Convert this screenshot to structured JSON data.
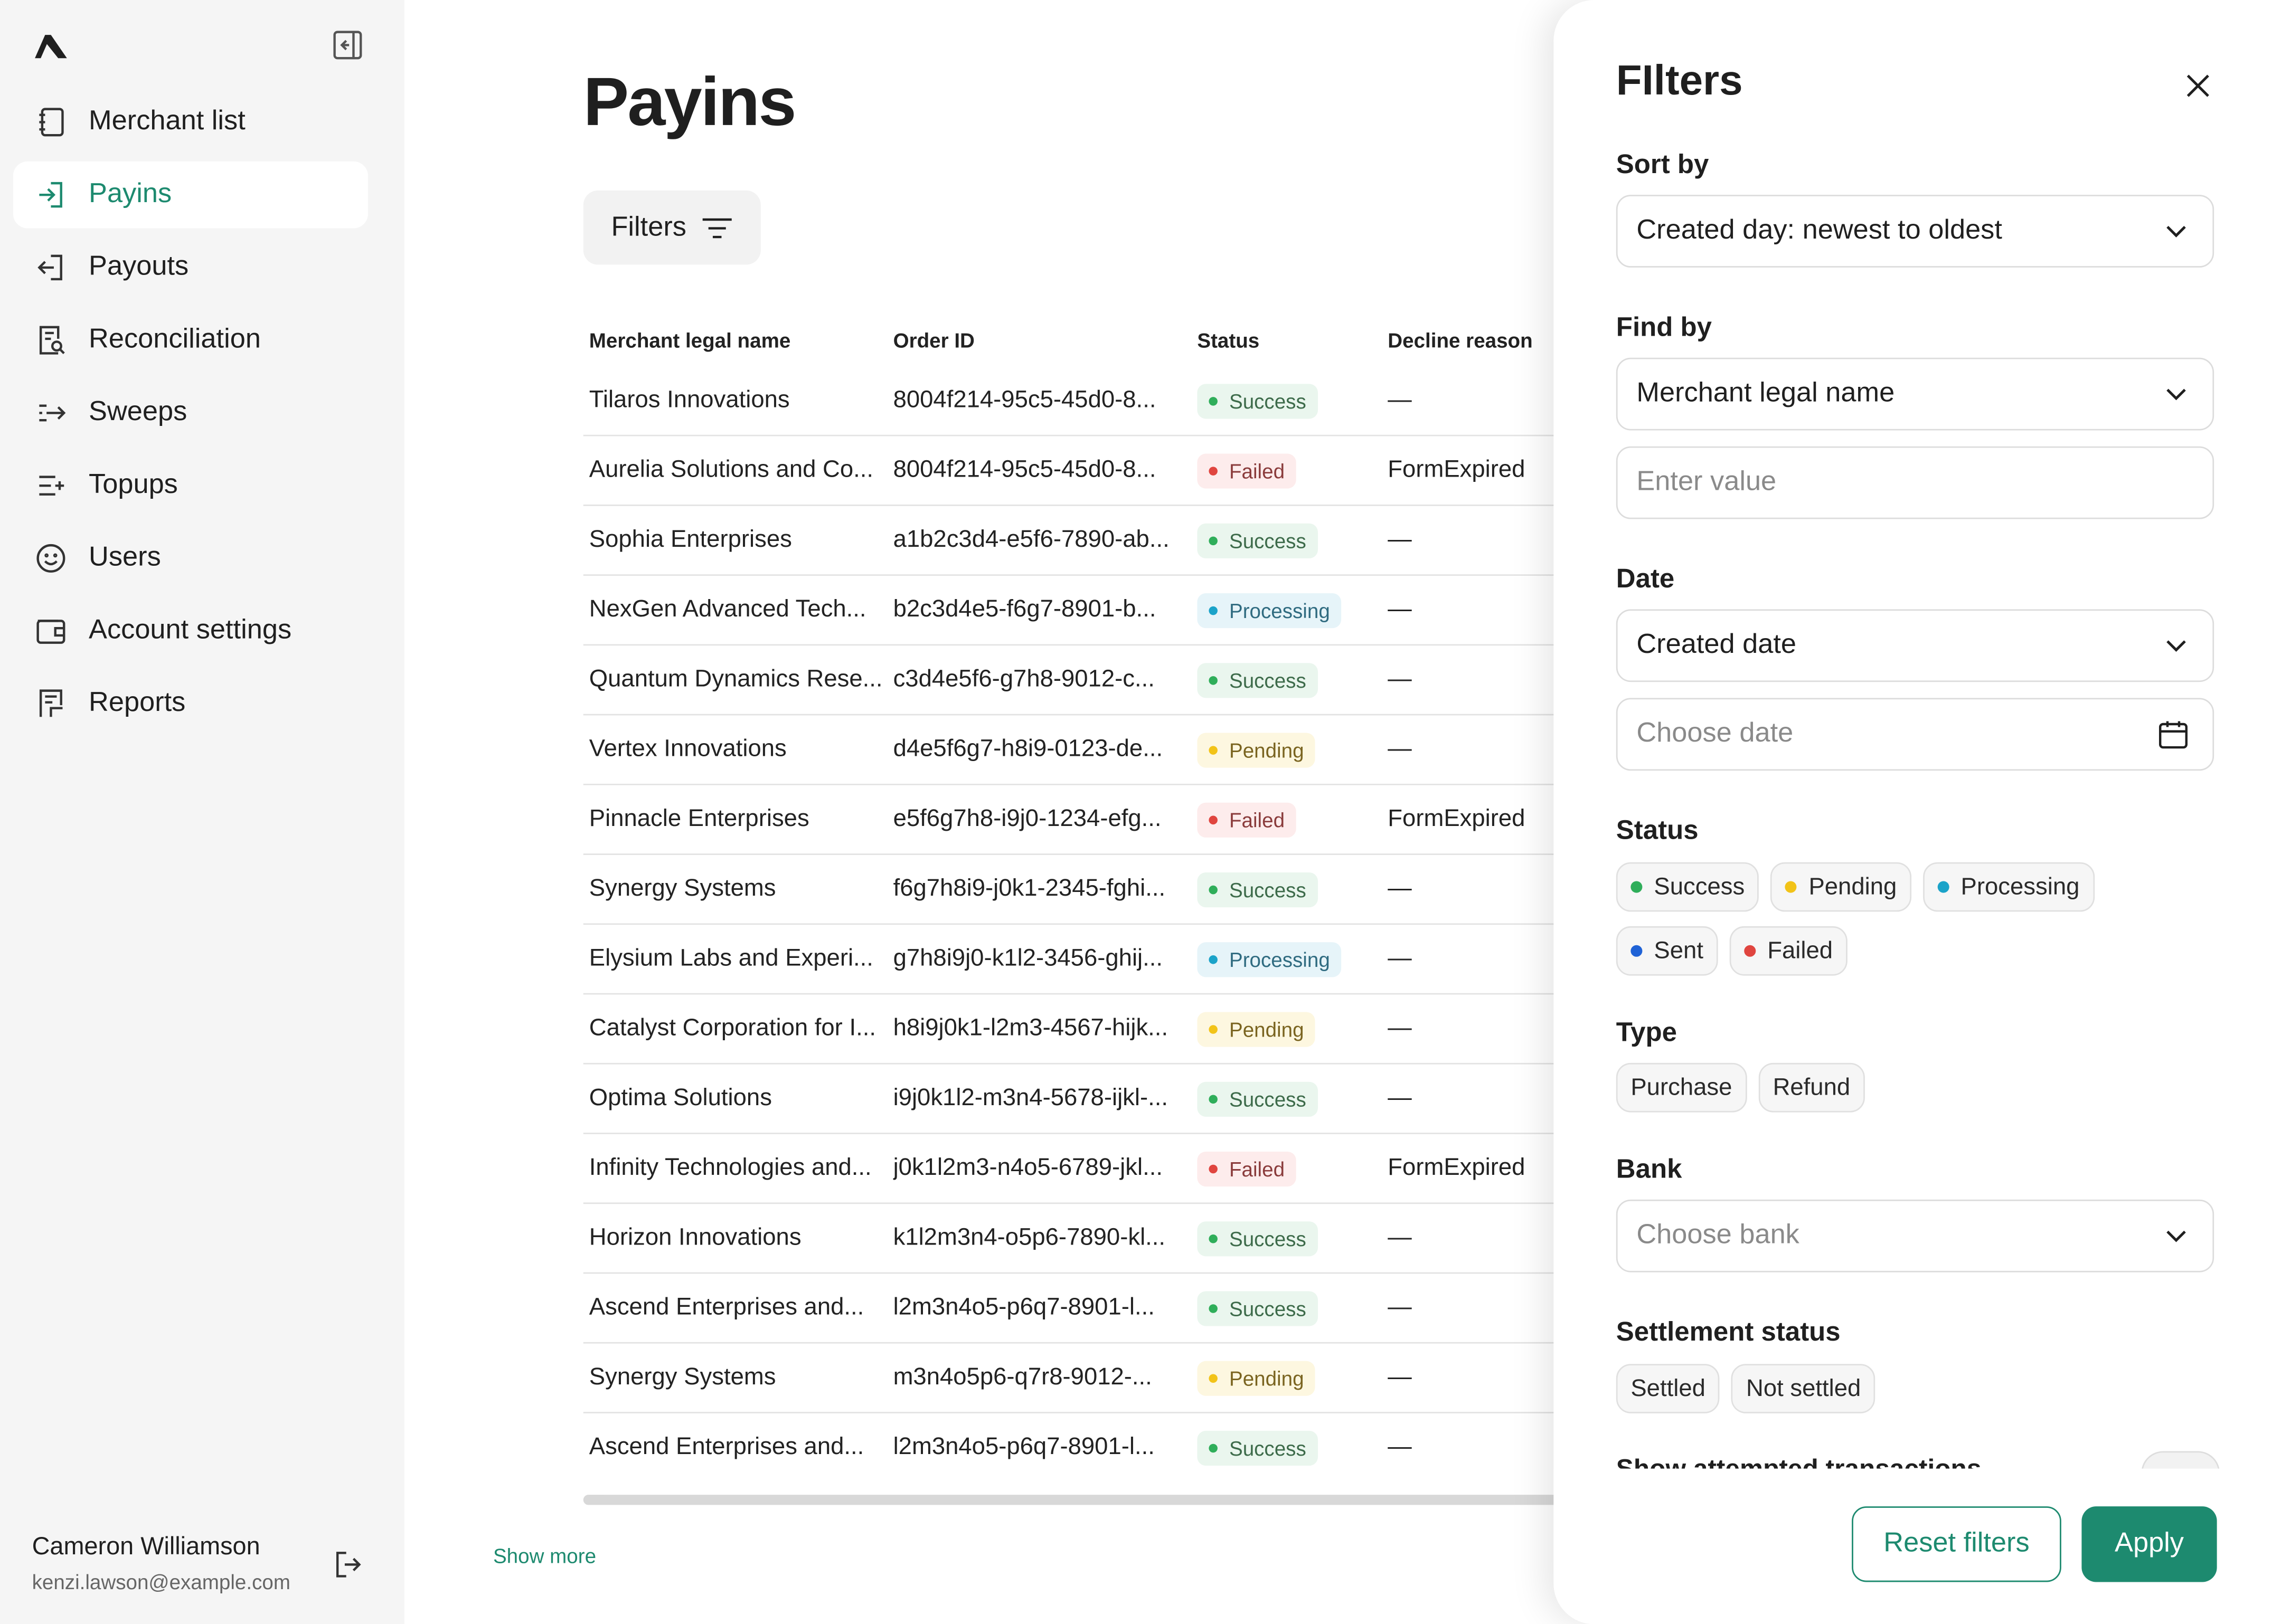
{
  "sidebar": {
    "items": [
      {
        "label": "Merchant list",
        "icon": "notebook-icon"
      },
      {
        "label": "Payins",
        "icon": "login-arrow-icon"
      },
      {
        "label": "Payouts",
        "icon": "logout-arrow-icon"
      },
      {
        "label": "Reconciliation",
        "icon": "document-search-icon"
      },
      {
        "label": "Sweeps",
        "icon": "sweep-arrow-icon"
      },
      {
        "label": "Topups",
        "icon": "list-plus-icon"
      },
      {
        "label": "Users",
        "icon": "smiley-icon"
      },
      {
        "label": "Account settings",
        "icon": "wallet-icon"
      },
      {
        "label": "Reports",
        "icon": "report-icon"
      }
    ],
    "user": {
      "name": "Cameron Williamson",
      "email": "kenzi.lawson@example.com"
    }
  },
  "main": {
    "title": "Payins",
    "filters_button": "Filters",
    "columns": [
      "Merchant legal name",
      "Order ID",
      "Status",
      "Decline reason"
    ],
    "rows": [
      {
        "merchant": "Tilaros Innovations",
        "order": "8004f214-95c5-45d0-8...",
        "status": "Success",
        "reason": "—"
      },
      {
        "merchant": "Aurelia Solutions and Co...",
        "order": "8004f214-95c5-45d0-8...",
        "status": "Failed",
        "reason": "FormExpired"
      },
      {
        "merchant": "Sophia Enterprises",
        "order": "a1b2c3d4-e5f6-7890-ab...",
        "status": "Success",
        "reason": "—"
      },
      {
        "merchant": "NexGen Advanced Tech...",
        "order": "b2c3d4e5-f6g7-8901-b...",
        "status": "Processing",
        "reason": "—"
      },
      {
        "merchant": "Quantum Dynamics Rese...",
        "order": "c3d4e5f6-g7h8-9012-c...",
        "status": "Success",
        "reason": "—"
      },
      {
        "merchant": "Vertex Innovations",
        "order": "d4e5f6g7-h8i9-0123-de...",
        "status": "Pending",
        "reason": "—"
      },
      {
        "merchant": "Pinnacle Enterprises",
        "order": "e5f6g7h8-i9j0-1234-efg...",
        "status": "Failed",
        "reason": "FormExpired"
      },
      {
        "merchant": "Synergy Systems",
        "order": "f6g7h8i9-j0k1-2345-fghi...",
        "status": "Success",
        "reason": "—"
      },
      {
        "merchant": "Elysium Labs and Experi...",
        "order": "g7h8i9j0-k1l2-3456-ghij...",
        "status": "Processing",
        "reason": "—"
      },
      {
        "merchant": "Catalyst Corporation for I...",
        "order": "h8i9j0k1-l2m3-4567-hijk...",
        "status": "Pending",
        "reason": "—"
      },
      {
        "merchant": "Optima Solutions",
        "order": "i9j0k1l2-m3n4-5678-ijkl-...",
        "status": "Success",
        "reason": "—"
      },
      {
        "merchant": "Infinity Technologies and...",
        "order": "j0k1l2m3-n4o5-6789-jkl...",
        "status": "Failed",
        "reason": "FormExpired"
      },
      {
        "merchant": "Horizon Innovations",
        "order": "k1l2m3n4-o5p6-7890-kl...",
        "status": "Success",
        "reason": "—"
      },
      {
        "merchant": "Ascend Enterprises and...",
        "order": "l2m3n4o5-p6q7-8901-l...",
        "status": "Success",
        "reason": "—"
      },
      {
        "merchant": "Synergy Systems",
        "order": "m3n4o5p6-q7r8-9012-...",
        "status": "Pending",
        "reason": "—"
      },
      {
        "merchant": "Ascend Enterprises and...",
        "order": "l2m3n4o5-p6q7-8901-l...",
        "status": "Success",
        "reason": "—"
      }
    ],
    "show_more": "Show more"
  },
  "filters": {
    "title": "FIlters",
    "sort_by": {
      "label": "Sort by",
      "value": "Created day: newest to oldest"
    },
    "find_by": {
      "label": "Find by",
      "value": "Merchant legal name",
      "placeholder": "Enter value"
    },
    "date": {
      "label": "Date",
      "value": "Created date",
      "placeholder": "Choose date"
    },
    "status": {
      "label": "Status",
      "options": [
        {
          "label": "Success",
          "color": "#2fae5a"
        },
        {
          "label": "Pending",
          "color": "#f2c318"
        },
        {
          "label": "Processing",
          "color": "#1ba3c9"
        },
        {
          "label": "Sent",
          "color": "#1f62d6"
        },
        {
          "label": "Failed",
          "color": "#e0453f"
        }
      ]
    },
    "type": {
      "label": "Type",
      "options": [
        "Purchase",
        "Refund"
      ]
    },
    "bank": {
      "label": "Bank",
      "placeholder": "Choose bank"
    },
    "settlement": {
      "label": "Settlement status",
      "options": [
        "Settled",
        "Not settled"
      ]
    },
    "attempted_label": "Show attempted transactions",
    "reset_label": "Reset filters",
    "apply_label": "Apply"
  },
  "colors": {
    "accent": "#1d8a6f"
  }
}
